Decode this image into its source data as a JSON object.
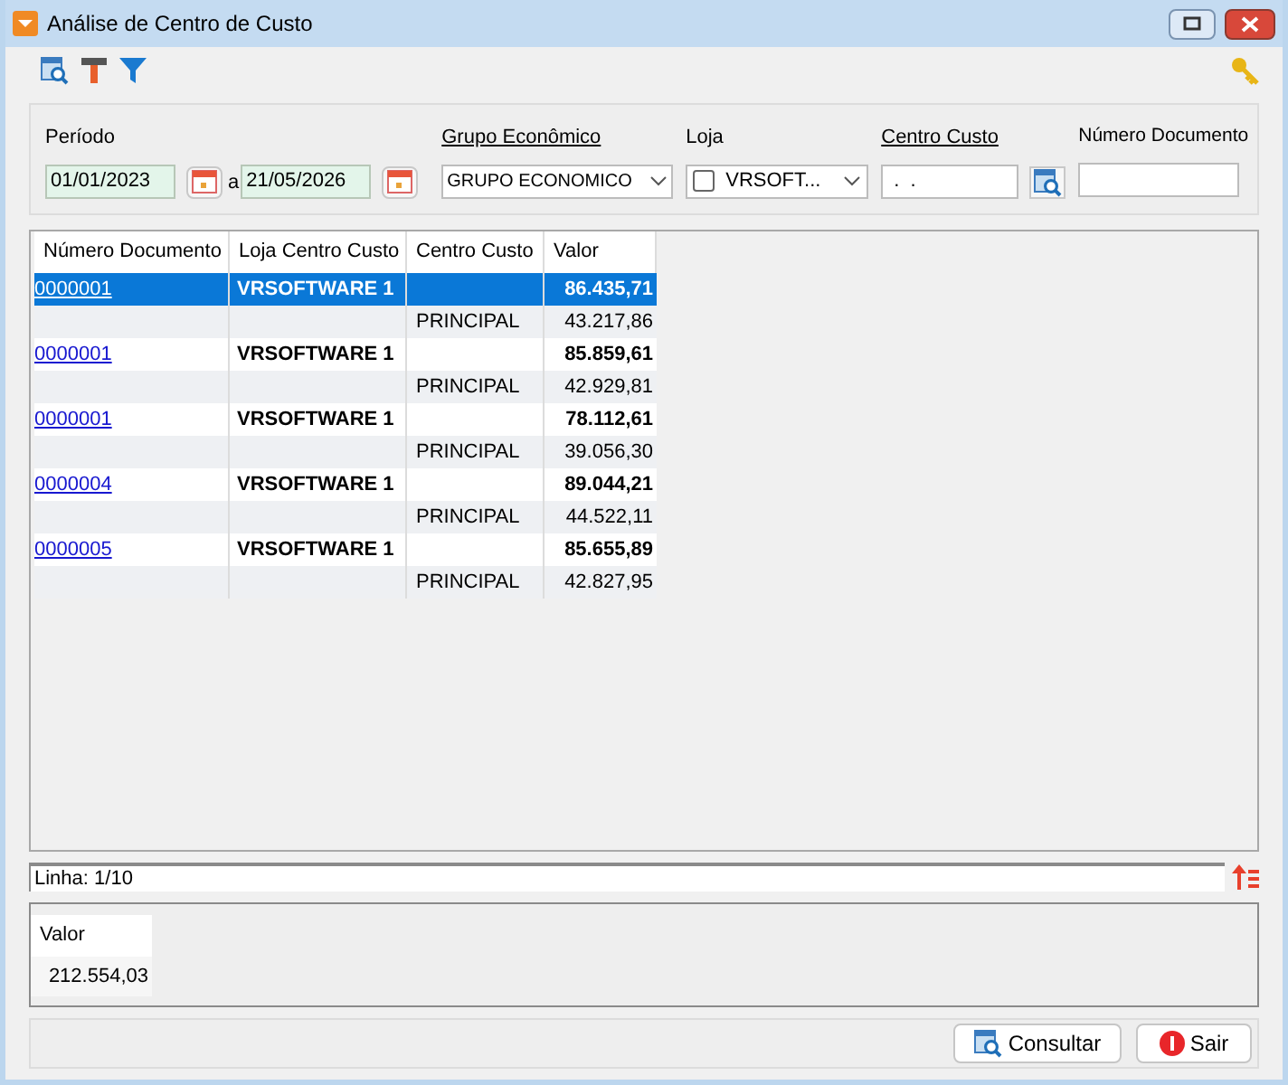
{
  "window": {
    "title": "Análise de Centro de Custo"
  },
  "filters": {
    "periodo": {
      "label": "Período",
      "from": "01/01/2023",
      "separator": "a",
      "to": "21/05/2026"
    },
    "grupo": {
      "label": "Grupo Econômico",
      "value": "GRUPO ECONOMICO"
    },
    "loja": {
      "label": "Loja",
      "value": "VRSOFT...",
      "checked": false
    },
    "centro": {
      "label": "Centro Custo",
      "value": ".  ."
    },
    "documento": {
      "label": "Número Documento"
    }
  },
  "table": {
    "columns": [
      "Número Documento",
      "Loja Centro Custo",
      "Centro Custo",
      "Valor"
    ],
    "rows": [
      {
        "kind": "main",
        "selected": true,
        "documento": "0000001",
        "loja": "VRSOFTWARE 1",
        "centro": "",
        "valor": "86.435,71"
      },
      {
        "kind": "sub",
        "selected": false,
        "documento": "",
        "loja": "",
        "centro": "PRINCIPAL",
        "valor": "43.217,86"
      },
      {
        "kind": "main",
        "selected": false,
        "documento": "0000001",
        "loja": "VRSOFTWARE 1",
        "centro": "",
        "valor": "85.859,61"
      },
      {
        "kind": "sub",
        "selected": false,
        "documento": "",
        "loja": "",
        "centro": "PRINCIPAL",
        "valor": "42.929,81"
      },
      {
        "kind": "main",
        "selected": false,
        "documento": "0000001",
        "loja": "VRSOFTWARE 1",
        "centro": "",
        "valor": "78.112,61"
      },
      {
        "kind": "sub",
        "selected": false,
        "documento": "",
        "loja": "",
        "centro": "PRINCIPAL",
        "valor": "39.056,30"
      },
      {
        "kind": "main",
        "selected": false,
        "documento": "0000004",
        "loja": "VRSOFTWARE 1",
        "centro": "",
        "valor": "89.044,21"
      },
      {
        "kind": "sub",
        "selected": false,
        "documento": "",
        "loja": "",
        "centro": "PRINCIPAL",
        "valor": "44.522,11"
      },
      {
        "kind": "main",
        "selected": false,
        "documento": "0000005",
        "loja": "VRSOFTWARE 1",
        "centro": "",
        "valor": "85.655,89"
      },
      {
        "kind": "sub",
        "selected": false,
        "documento": "",
        "loja": "",
        "centro": "PRINCIPAL",
        "valor": "42.827,95"
      }
    ]
  },
  "status_bar": {
    "text": "Linha: 1/10"
  },
  "totals": {
    "label": "Valor",
    "value": "212.554,03"
  },
  "buttons": [
    "Consultar",
    "Sair"
  ]
}
